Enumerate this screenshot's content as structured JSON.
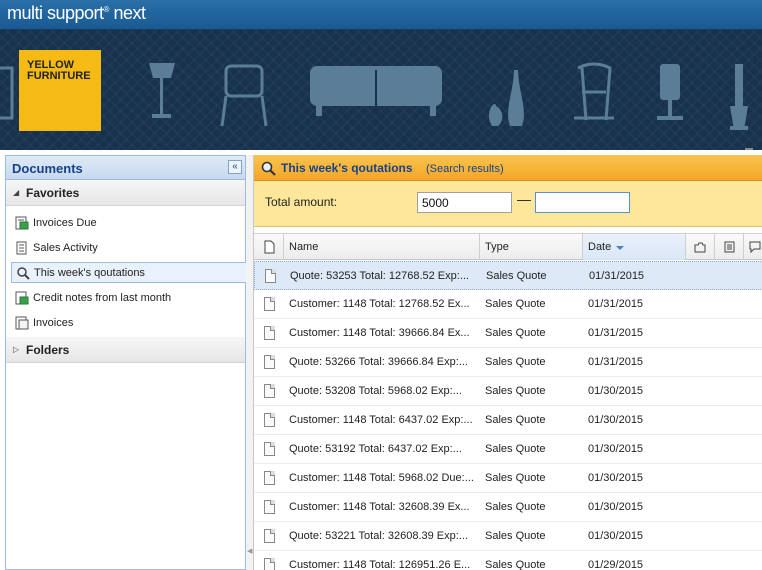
{
  "app": {
    "title": "multi support",
    "title_suffix": "next",
    "reg": "®"
  },
  "banner": {
    "logo_line1": "YELLOW",
    "logo_line2": "FURNITURE"
  },
  "documents_panel": {
    "title": "Documents",
    "collapse_symbol": "«",
    "favorites_label": "Favorites",
    "folders_label": "Folders",
    "items": [
      {
        "label": "Invoices Due",
        "icon": "invoices-due-icon"
      },
      {
        "label": "Sales Activity",
        "icon": "sales-activity-icon"
      },
      {
        "label": "This week's qoutations",
        "icon": "search-icon",
        "selected": true
      },
      {
        "label": "Credit notes from last month",
        "icon": "credit-notes-icon"
      },
      {
        "label": "Invoices",
        "icon": "invoices-icon"
      }
    ]
  },
  "results": {
    "title": "This week's qoutations",
    "subtitle": "(Search results)",
    "filter": {
      "label": "Total amount:",
      "min_value": "5000",
      "max_value": "",
      "dash": "—"
    },
    "columns": {
      "name": "Name",
      "type": "Type",
      "date": "Date"
    },
    "rows": [
      {
        "name": "Quote: 53253 Total: 12768.52 Exp:...",
        "type": "Sales Quote",
        "date": "01/31/2015"
      },
      {
        "name": "Customer: 1148 Total: 12768.52 Ex...",
        "type": "Sales Quote",
        "date": "01/31/2015"
      },
      {
        "name": "Customer: 1148 Total: 39666.84 Ex...",
        "type": "Sales Quote",
        "date": "01/31/2015"
      },
      {
        "name": "Quote: 53266 Total: 39666.84 Exp:...",
        "type": "Sales Quote",
        "date": "01/31/2015"
      },
      {
        "name": "Quote: 53208 Total: 5968.02 Exp:...",
        "type": "Sales Quote",
        "date": "01/30/2015"
      },
      {
        "name": "Customer: 1148 Total: 6437.02 Exp:...",
        "type": "Sales Quote",
        "date": "01/30/2015"
      },
      {
        "name": "Quote: 53192 Total: 6437.02 Exp:...",
        "type": "Sales Quote",
        "date": "01/30/2015"
      },
      {
        "name": "Customer: 1148 Total: 5968.02 Due:...",
        "type": "Sales Quote",
        "date": "01/30/2015"
      },
      {
        "name": "Customer: 1148 Total: 32608.39 Ex...",
        "type": "Sales Quote",
        "date": "01/30/2015"
      },
      {
        "name": "Quote: 53221 Total: 32608.39 Exp:...",
        "type": "Sales Quote",
        "date": "01/30/2015"
      },
      {
        "name": "Customer: 1148 Total: 126951.26 E...",
        "type": "Sales Quote",
        "date": "01/29/2015"
      }
    ]
  },
  "colors": {
    "accent_blue": "#15428b",
    "header_orange": "#f4a629",
    "filter_yellow": "#fce79a",
    "logo_yellow": "#f5ba14",
    "banner_navy": "#17324d"
  }
}
